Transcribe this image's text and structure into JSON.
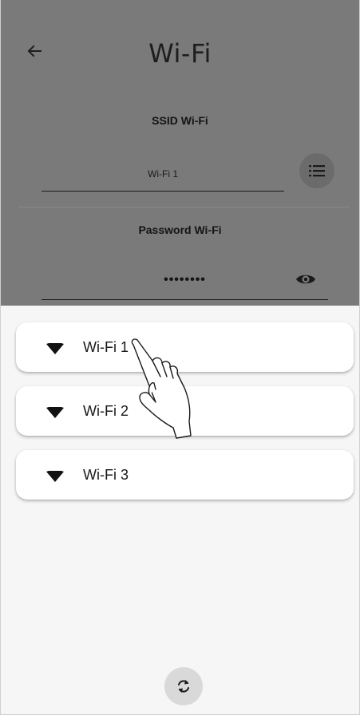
{
  "header": {
    "title": "Wi-Fi",
    "back_icon": "arrow-left-icon"
  },
  "ssid": {
    "label": "SSID Wi-Fi",
    "value": "Wi-Fi 1",
    "list_icon": "list-icon"
  },
  "password": {
    "label": "Password Wi-Fi",
    "value": "••••••••",
    "visibility_icon": "eye-icon"
  },
  "networks": [
    {
      "name": "Wi-Fi 1",
      "icon": "wifi-icon"
    },
    {
      "name": "Wi-Fi 2",
      "icon": "wifi-icon"
    },
    {
      "name": "Wi-Fi 3",
      "icon": "wifi-icon"
    }
  ],
  "footer": {
    "refresh_icon": "refresh-icon"
  },
  "colors": {
    "overlay": "#7a7a7a",
    "sheet": "#f6f6f6",
    "card": "#ffffff",
    "refresh_button": "#d9d9d9"
  }
}
